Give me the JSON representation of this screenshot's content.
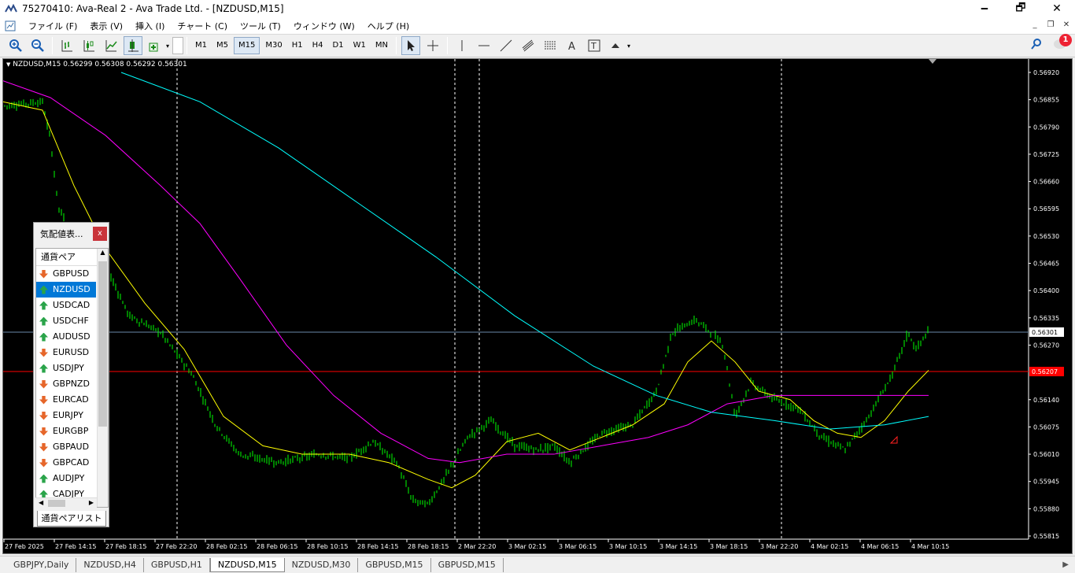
{
  "window": {
    "title": "75270410: Ava-Real 2 - Ava Trade Ltd. - [NZDUSD,M15]",
    "minimize": "🗕",
    "maximize": "🗗",
    "close": "✕"
  },
  "menu": [
    "ファイル (F)",
    "表示 (V)",
    "挿入 (I)",
    "チャート (C)",
    "ツール (T)",
    "ウィンドウ (W)",
    "ヘルプ (H)"
  ],
  "toolbar": {
    "timeframes": [
      "M1",
      "M5",
      "M15",
      "M30",
      "H1",
      "H4",
      "D1",
      "W1",
      "MN"
    ],
    "active_timeframe": "M15"
  },
  "notifications": {
    "count": "1"
  },
  "chart": {
    "header": "NZDUSD,M15  0.56299 0.56308 0.56292 0.56301",
    "current_price": "0.56301",
    "red_line_price": "0.56207",
    "price_labels": [
      "0.56920",
      "0.56855",
      "0.56790",
      "0.56725",
      "0.56660",
      "0.56595",
      "0.56530",
      "0.56465",
      "0.56400",
      "0.56335",
      "0.56270",
      "0.56140",
      "0.56075",
      "0.56010",
      "0.55945",
      "0.55880",
      "0.55815"
    ],
    "time_labels": [
      "27 Feb 2025",
      "27 Feb 14:15",
      "27 Feb 18:15",
      "27 Feb 22:20",
      "28 Feb 02:15",
      "28 Feb 06:15",
      "28 Feb 10:15",
      "28 Feb 14:15",
      "28 Feb 18:15",
      "2 Mar 22:20",
      "3 Mar 02:15",
      "3 Mar 06:15",
      "3 Mar 10:15",
      "3 Mar 14:15",
      "3 Mar 18:15",
      "3 Mar 22:20",
      "4 Mar 02:15",
      "4 Mar 06:15",
      "4 Mar 10:15"
    ],
    "colors": {
      "background": "#000000",
      "candles": "#00ff00",
      "ma_fast": "#ffff00",
      "ma_mid": "#ff00ff",
      "ma_slow": "#00ffff",
      "bid_line": "#ff0000"
    }
  },
  "market_watch": {
    "title": "気配値表...",
    "close": "x",
    "column": "通貨ペア",
    "tab": "通貨ペアリスト",
    "symbols": [
      {
        "name": "GBPUSD",
        "dir": "down"
      },
      {
        "name": "NZDUSD",
        "dir": "up",
        "selected": true
      },
      {
        "name": "USDCAD",
        "dir": "up"
      },
      {
        "name": "USDCHF",
        "dir": "up"
      },
      {
        "name": "AUDUSD",
        "dir": "up"
      },
      {
        "name": "EURUSD",
        "dir": "down"
      },
      {
        "name": "USDJPY",
        "dir": "up"
      },
      {
        "name": "GBPNZD",
        "dir": "down"
      },
      {
        "name": "EURCAD",
        "dir": "down"
      },
      {
        "name": "EURJPY",
        "dir": "down"
      },
      {
        "name": "EURGBP",
        "dir": "down"
      },
      {
        "name": "GBPAUD",
        "dir": "down"
      },
      {
        "name": "GBPCAD",
        "dir": "down"
      },
      {
        "name": "AUDJPY",
        "dir": "up"
      },
      {
        "name": "CADJPY",
        "dir": "up"
      }
    ]
  },
  "tabs": [
    "GBPJPY,Daily",
    "NZDUSD,H4",
    "GBPUSD,H1",
    "NZDUSD,M15",
    "NZDUSD,M30",
    "GBPUSD,M15",
    "GBPUSD,M15"
  ],
  "active_tab": "NZDUSD,M15"
}
